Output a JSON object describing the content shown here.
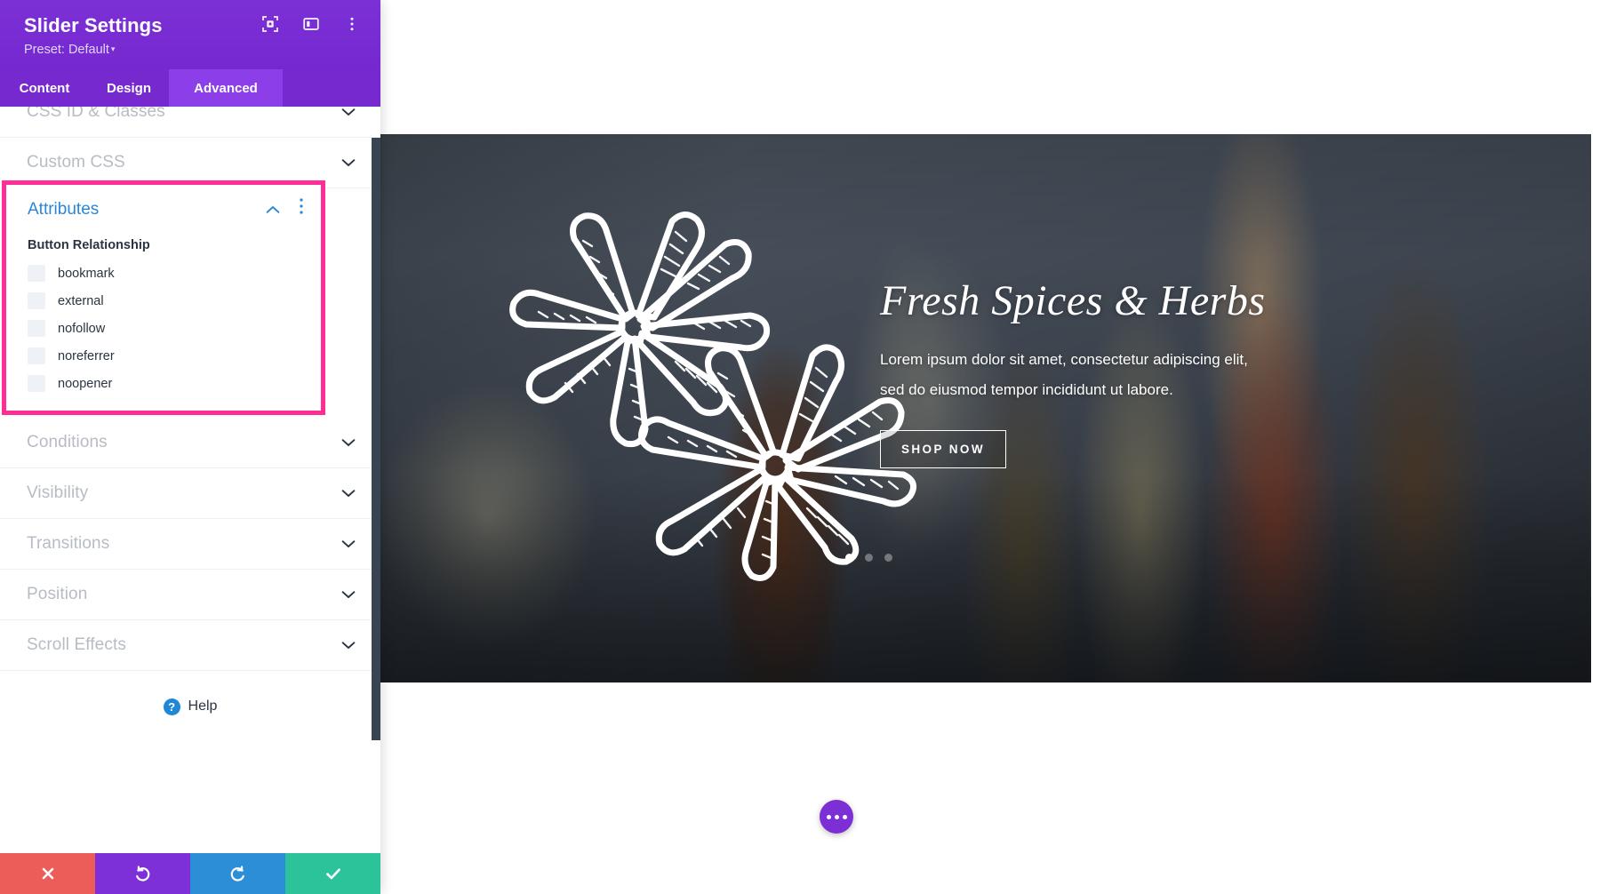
{
  "sidebar": {
    "title": "Slider Settings",
    "preset": "Preset: Default",
    "preset_caret": "▾",
    "header_icons": [
      {
        "name": "focus-target-icon"
      },
      {
        "name": "panel-layout-icon"
      },
      {
        "name": "more-vertical-icon"
      }
    ],
    "tabs": [
      {
        "label": "Content",
        "active": false
      },
      {
        "label": "Design",
        "active": false
      },
      {
        "label": "Advanced",
        "active": true
      }
    ],
    "sections": [
      {
        "label": "CSS ID & Classes",
        "expanded": false
      },
      {
        "label": "Custom CSS",
        "expanded": false
      },
      {
        "label": "Conditions",
        "expanded": false
      },
      {
        "label": "Visibility",
        "expanded": false
      },
      {
        "label": "Transitions",
        "expanded": false
      },
      {
        "label": "Position",
        "expanded": false
      },
      {
        "label": "Scroll Effects",
        "expanded": false
      }
    ],
    "attributes": {
      "title": "Attributes",
      "field_label": "Button Relationship",
      "options": [
        {
          "label": "bookmark",
          "checked": false
        },
        {
          "label": "external",
          "checked": false
        },
        {
          "label": "nofollow",
          "checked": false
        },
        {
          "label": "noreferrer",
          "checked": false
        },
        {
          "label": "noopener",
          "checked": false
        }
      ],
      "highlight_color": "#ff2d96",
      "title_color": "#2a87d8"
    },
    "help": {
      "label": "Help",
      "icon_char": "?"
    },
    "actions": [
      {
        "name": "cancel",
        "icon": "close-icon",
        "color": "#ec5c58"
      },
      {
        "name": "undo",
        "icon": "undo-icon",
        "color": "#7d2fd8"
      },
      {
        "name": "redo",
        "icon": "redo-icon",
        "color": "#2d8ed8"
      },
      {
        "name": "save",
        "icon": "check-icon",
        "color": "#2dc39a"
      }
    ],
    "accent_purple": "#7b2fd4",
    "tab_active_purple": "#8c3ee8"
  },
  "canvas": {
    "hero": {
      "heading": "Fresh Spices & Herbs",
      "paragraph": "Lorem ipsum dolor sit amet, consectetur adipiscing elit, sed do eiusmod tempor incididunt ut labore.",
      "button_label": "SHOP NOW",
      "dots": [
        {
          "active": true
        },
        {
          "active": false
        },
        {
          "active": false
        }
      ],
      "decor": "star-anise-illustration"
    },
    "fab": {
      "name": "page-settings-fab",
      "icon": "ellipsis-icon"
    }
  }
}
